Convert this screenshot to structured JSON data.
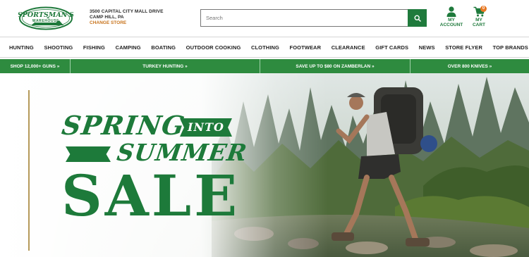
{
  "header": {
    "logo_text": "SPORTSMAN'S WAREHOUSE",
    "store": {
      "address": "3500 CAPITAL CITY MALL DRIVE",
      "city": "CAMP HILL, PA",
      "change_label": "CHANGE STORE"
    },
    "search": {
      "placeholder": "Search"
    },
    "account": {
      "line1": "MY",
      "line2": "ACCOUNT"
    },
    "cart": {
      "line1": "MY",
      "line2": "CART",
      "count": "0"
    }
  },
  "nav": {
    "categories": [
      "HUNTING",
      "SHOOTING",
      "FISHING",
      "CAMPING",
      "BOATING",
      "OUTDOOR COOKING",
      "CLOTHING",
      "FOOTWEAR",
      "CLEARANCE",
      "GIFT CARDS",
      "NEWS",
      "STORE FLYER",
      "TOP BRANDS"
    ]
  },
  "promos": [
    "SHOP 12,000+ GUNS »",
    "TURKEY HUNTING »",
    "SAVE UP TO $80 ON ZAMBERLAN »",
    "OVER 800 KNIVES »"
  ],
  "hero": {
    "line1": "SPRING",
    "line1b": "INTO",
    "line2": "SUMMER",
    "line3": "SALE"
  },
  "colors": {
    "brand_green": "#1f7a3c",
    "promo_green": "#2e8b3f",
    "accent_orange": "#c8741d"
  }
}
